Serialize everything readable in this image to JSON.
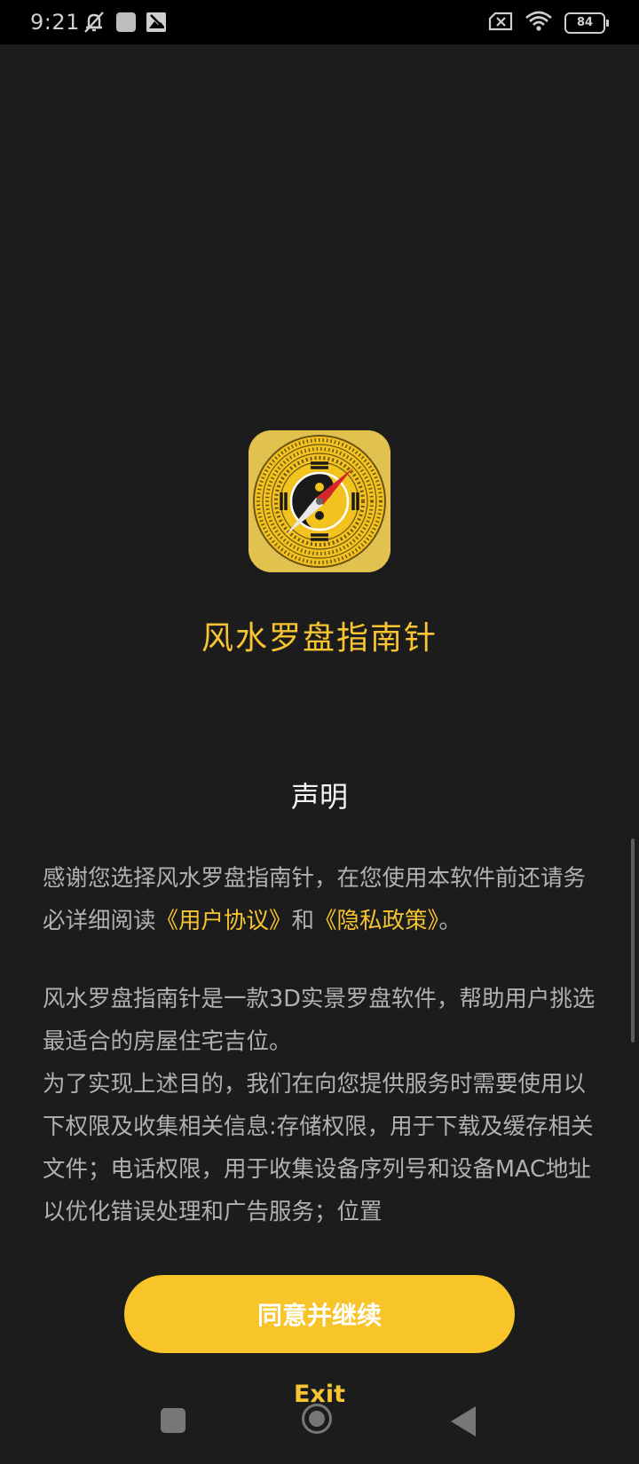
{
  "status_bar": {
    "time": "9:21",
    "battery": "84",
    "left_icons": [
      "mute-icon",
      "app-notification-icon",
      "image-icon"
    ],
    "right_icons": [
      "sim-none-icon",
      "wifi-icon",
      "battery-icon"
    ]
  },
  "app": {
    "title": "风水罗盘指南针",
    "icon": "compass-app-icon"
  },
  "declaration": {
    "title": "声明",
    "p1_text": "感谢您选择风水罗盘指南针，在您使用本软件前还请务必详细阅读",
    "link_user_agreement": "《用户协议》",
    "and": "和",
    "link_privacy_policy": "《隐私政策》",
    "period": "。",
    "p2": "风水罗盘指南针是一款3D实景罗盘软件，帮助用户挑选最适合的房屋住宅吉位。",
    "p3": "为了实现上述目的，我们在向您提供服务时需要使用以下权限及收集相关信息:存储权限，用于下载及缓存相关文件；电话权限，用于收集设备序列号和设备MAC地址以优化错误处理和广告服务；位置"
  },
  "buttons": {
    "agree": "同意并继续",
    "exit": "Exit"
  },
  "nav_bar": {
    "icons": [
      "recent-apps-icon",
      "home-icon",
      "back-icon"
    ]
  },
  "colors": {
    "accent": "#f7c531",
    "background": "#1c1c1c"
  }
}
